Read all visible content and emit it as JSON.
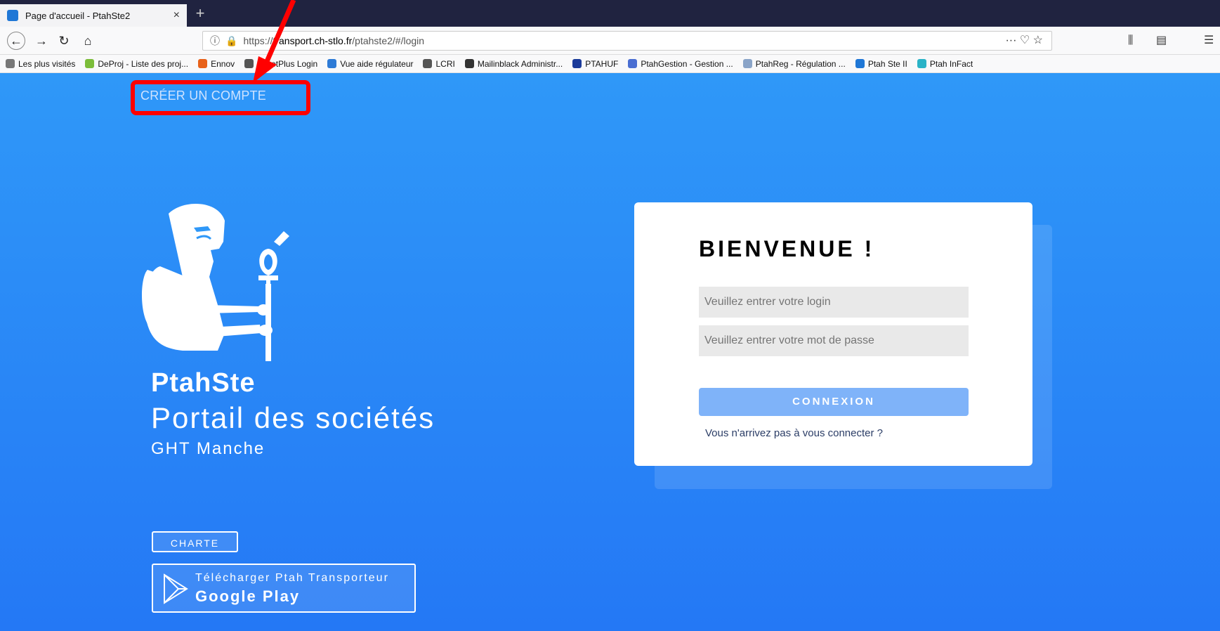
{
  "browser": {
    "tab_title": "Page d'accueil - PtahSte2",
    "tab_close": "×",
    "new_tab": "+",
    "url_prefix": "https://t",
    "url_domain": "ransport.ch-stlo.fr",
    "url_path": "/ptahste2/#/login",
    "url_actions": "··· ♡ ☆",
    "bookmarks": [
      {
        "label": "Les plus visités",
        "icon_color": "#777777"
      },
      {
        "label": "DeProj - Liste des proj...",
        "icon_color": "#7cbd3a"
      },
      {
        "label": "Ennov",
        "icon_color": "#e8621a"
      },
      {
        "label": "AssetPlus Login",
        "icon_color": "#555555"
      },
      {
        "label": "Vue aide régulateur",
        "icon_color": "#2e7bd6"
      },
      {
        "label": "LCRI",
        "icon_color": "#555555"
      },
      {
        "label": "Mailinblack Administr...",
        "icon_color": "#333333"
      },
      {
        "label": "PTAHUF",
        "icon_color": "#1b3b9a"
      },
      {
        "label": "PtahGestion - Gestion ...",
        "icon_color": "#4a6ed2"
      },
      {
        "label": "PtahReg - Régulation ...",
        "icon_color": "#8aa4c8"
      },
      {
        "label": "Ptah Ste II",
        "icon_color": "#1f77d6"
      },
      {
        "label": "Ptah InFact",
        "icon_color": "#2ab3c7"
      }
    ]
  },
  "page": {
    "create_account": "CRÉER UN COMPTE",
    "brand_name": "PtahSte",
    "brand_subtitle": "Portail des sociétés",
    "brand_region": "GHT Manche",
    "charte_label": "CHARTE",
    "gplay_small": "Télécharger Ptah Transporteur",
    "gplay_big": "Google Play"
  },
  "login": {
    "welcome": "BIENVENUE !",
    "login_placeholder": "Veuillez entrer votre login",
    "password_placeholder": "Veuillez entrer votre mot de passe",
    "connect_label": "CONNEXION",
    "forgot_label": "Vous n'arrivez pas à vous connecter ?"
  },
  "colors": {
    "annotation": "#ff0000",
    "page_bg_top": "#2f98f8",
    "page_bg_bottom": "#2478f5",
    "connect_button": "#7fb3f9"
  }
}
